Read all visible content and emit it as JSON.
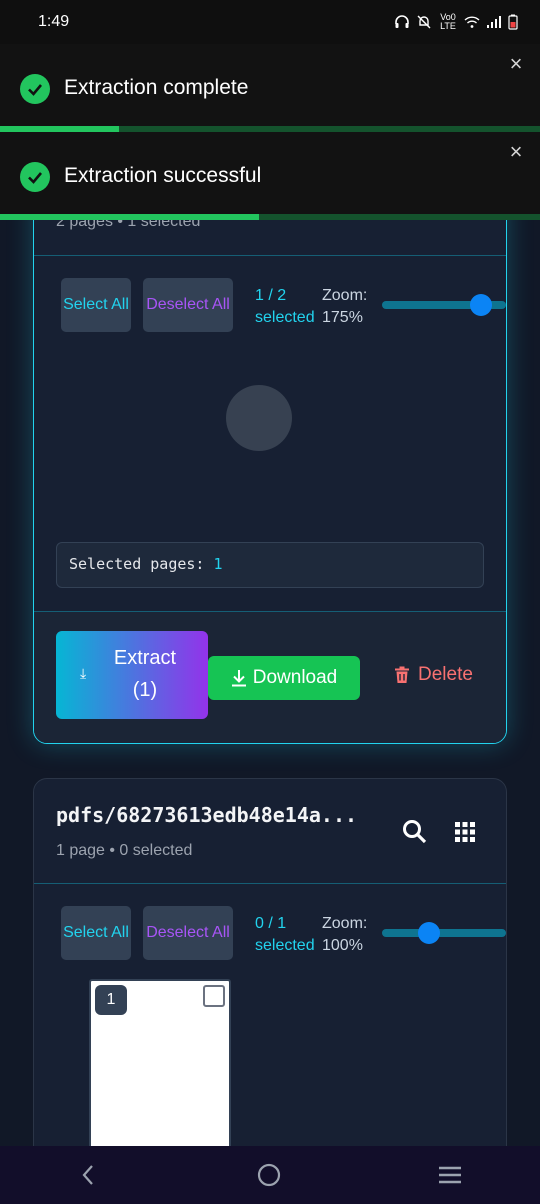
{
  "status_bar": {
    "time": "1:49",
    "network": "Vo0 LTE"
  },
  "toasts": [
    {
      "message": "Extraction complete",
      "close": "×",
      "progress": 0.22
    },
    {
      "message": "Extraction successful",
      "close": "×",
      "progress": 0.48
    }
  ],
  "card1": {
    "meta": "2 pages • 1 selected",
    "select_all": "Select All",
    "deselect_all": "Deselect All",
    "selected_count": "1 / 2 selected",
    "zoom_label": "Zoom:",
    "zoom_value": "175%",
    "zoom_fraction": 0.8,
    "selected_pages_label": "Selected pages:",
    "selected_pages_value": "1",
    "extract_label": "Extract",
    "extract_count": "(1)",
    "download_label": "Download",
    "delete_label": "Delete"
  },
  "card2": {
    "title": "pdfs/68273613edb48e14a...",
    "meta": "1 page • 0 selected",
    "select_all": "Select All",
    "deselect_all": "Deselect All",
    "selected_count": "0 / 1 selected",
    "zoom_label": "Zoom:",
    "zoom_value": "100%",
    "zoom_fraction": 0.38,
    "thumbnail_page": "1"
  },
  "colors": {
    "accent_cyan": "#22d3ee",
    "accent_purple": "#a855f7",
    "success": "#22c55e",
    "danger": "#f87171"
  }
}
